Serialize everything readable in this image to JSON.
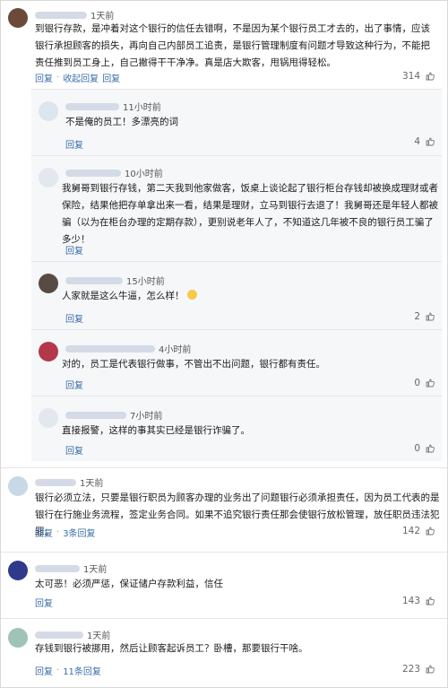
{
  "comments": [
    {
      "time": "1天前",
      "text": "到银行存款，是冲着对这个银行的信任去错啊，不是因为某个银行员工才去的，出了事情，应该银行承担顾客的损失，再向自己内部员工追责，是银行管理制度有问题才导致这种行为，不能把责任推到员工身上，自己撇得干干净净。真是店大欺客，甩锅甩得轻松。",
      "reply_label": "回复",
      "collapse_label": "收起回复",
      "likes": "314",
      "avatar_color": "#6b4a3a"
    },
    {
      "time": "1天前",
      "text": "银行必须立法，只要是银行职员为顾客办理的业务出了问题银行必须承担责任，因为员工代表的是银行在行施业务流程，签定业务合同。如果不追究银行责任那会使银行放松管理，放任职员违法犯罪。",
      "reply_label": "回复",
      "replies_label": "3条回复",
      "likes": "142",
      "avatar_color": "#c9d8e6"
    },
    {
      "time": "1天前",
      "text": "太可恶！必须严惩，保证储户存款利益，信任",
      "reply_label": "回复",
      "likes": "143",
      "avatar_color": "#2f3a8c"
    },
    {
      "time": "1天前",
      "text": "存钱到银行被挪用，然后让顾客起诉员工？卧槽，那要银行干啥。",
      "reply_label": "回复",
      "replies_label": "11条回复",
      "likes": "223",
      "avatar_color": "#9fc3b8"
    }
  ],
  "replies": [
    {
      "time": "11小时前",
      "text": "不是俺的员工！多漂亮的词",
      "reply_label": "回复",
      "likes": "4",
      "avatar_color": "#dde6ee"
    },
    {
      "time": "10小时前",
      "text": "我舅哥到银行存钱，第二天我到他家做客，饭桌上谈论起了银行柜台存钱却被换成理财或者保险，结果他把存单拿出来一看，结果是理财，立马到银行去退了！我舅哥还是年轻人都被骗（以为在柜台办理的定期存款），更别说老年人了，不知道这几年被不良的银行员工骗了多少！",
      "reply_label": "回复",
      "avatar_color": "#e3e8ee"
    },
    {
      "time": "15小时前",
      "text": "人家就是这么牛逼，怎么样！",
      "reply_label": "回复",
      "likes": "2",
      "avatar_color": "#5a4a44"
    },
    {
      "time": "4小时前",
      "text": "对的，员工是代表银行做事，不管出不出问题，银行都有责任。",
      "reply_label": "回复",
      "likes": "0",
      "avatar_color": "#b2384a"
    },
    {
      "time": "7小时前",
      "text": "直接报警，这样的事其实已经是银行诈骗了。",
      "reply_label": "回复",
      "likes": "0",
      "avatar_color": "#e3e8ee"
    }
  ],
  "icons": {
    "like": "thumbs-up-icon",
    "emoji": "grinning-face-icon"
  }
}
